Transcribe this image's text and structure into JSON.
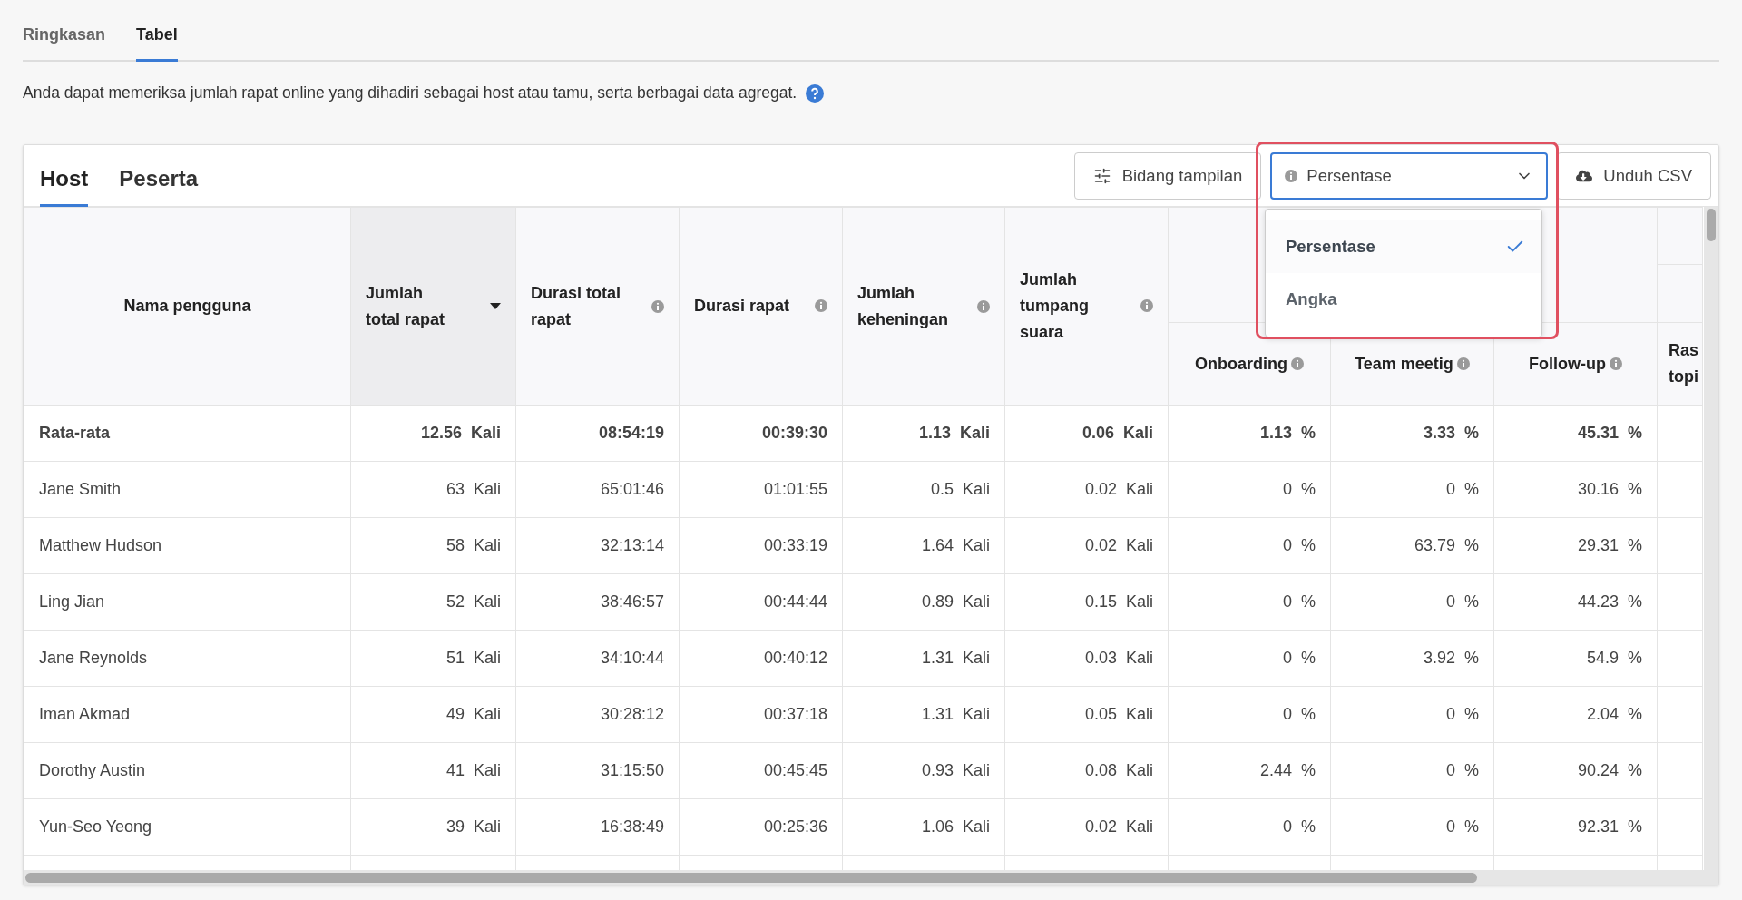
{
  "page_tabs": [
    {
      "label": "Ringkasan",
      "selected": false
    },
    {
      "label": "Tabel",
      "selected": true
    }
  ],
  "description": "Anda dapat memeriksa jumlah rapat online yang dihadiri sebagai host atau tamu, serta berbagai data agregat.",
  "card": {
    "tabs": [
      {
        "label": "Host",
        "selected": true
      },
      {
        "label": "Peserta",
        "selected": false
      }
    ],
    "display_fields_button": "Bidang tampilan",
    "select": {
      "value": "Persentase",
      "expanded": true,
      "options": [
        {
          "label": "Persentase",
          "selected": true
        },
        {
          "label": "Angka",
          "selected": false
        }
      ]
    },
    "download_button": "Unduh CSV"
  },
  "table": {
    "columns": [
      {
        "label": "Nama pengguna",
        "info": false,
        "sorted": false
      },
      {
        "label": "Jumlah total rapat",
        "info": false,
        "sorted": true
      },
      {
        "label": "Durasi total rapat",
        "info": true,
        "sorted": false
      },
      {
        "label": "Durasi rapat",
        "info": true,
        "sorted": false
      },
      {
        "label": "Jumlah keheningan",
        "info": true,
        "sorted": false
      },
      {
        "label": "Jumlah tumpang suara",
        "info": true,
        "sorted": false
      }
    ],
    "topic_columns": [
      {
        "label": "Onboarding",
        "info": true
      },
      {
        "label": "Team meetig",
        "info": true
      },
      {
        "label": "Follow-up",
        "info": true
      },
      {
        "label": "Ras topi",
        "info": false
      }
    ],
    "rows": [
      {
        "kind": "average",
        "cells": [
          "Rata-rata",
          "12.56 Kali",
          "08:54:19",
          "00:39:30",
          "1.13 Kali",
          "0.06 Kali",
          "1.13 %",
          "3.33 %",
          "45.31 %"
        ]
      },
      {
        "kind": "user",
        "cells": [
          "Jane Smith",
          "63 Kali",
          "65:01:46",
          "01:01:55",
          "0.5 Kali",
          "0.02 Kali",
          "0 %",
          "0 %",
          "30.16 %"
        ]
      },
      {
        "kind": "user",
        "cells": [
          "Matthew Hudson",
          "58 Kali",
          "32:13:14",
          "00:33:19",
          "1.64 Kali",
          "0.02 Kali",
          "0 %",
          "63.79 %",
          "29.31 %"
        ]
      },
      {
        "kind": "user",
        "cells": [
          "Ling Jian",
          "52 Kali",
          "38:46:57",
          "00:44:44",
          "0.89 Kali",
          "0.15 Kali",
          "0 %",
          "0 %",
          "44.23 %"
        ]
      },
      {
        "kind": "user",
        "cells": [
          "Jane Reynolds",
          "51 Kali",
          "34:10:44",
          "00:40:12",
          "1.31 Kali",
          "0.03 Kali",
          "0 %",
          "3.92 %",
          "54.9 %"
        ]
      },
      {
        "kind": "user",
        "cells": [
          "Iman Akmad",
          "49 Kali",
          "30:28:12",
          "00:37:18",
          "1.31 Kali",
          "0.05 Kali",
          "0 %",
          "0 %",
          "2.04 %"
        ]
      },
      {
        "kind": "user",
        "cells": [
          "Dorothy Austin",
          "41 Kali",
          "31:15:50",
          "00:45:45",
          "0.93 Kali",
          "0.08 Kali",
          "2.44 %",
          "0 %",
          "90.24 %"
        ]
      },
      {
        "kind": "user",
        "cells": [
          "Yun-Seo Yeong",
          "39 Kali",
          "16:38:49",
          "00:25:36",
          "1.06 Kali",
          "0.02 Kali",
          "0 %",
          "0 %",
          "92.31 %"
        ]
      }
    ]
  }
}
